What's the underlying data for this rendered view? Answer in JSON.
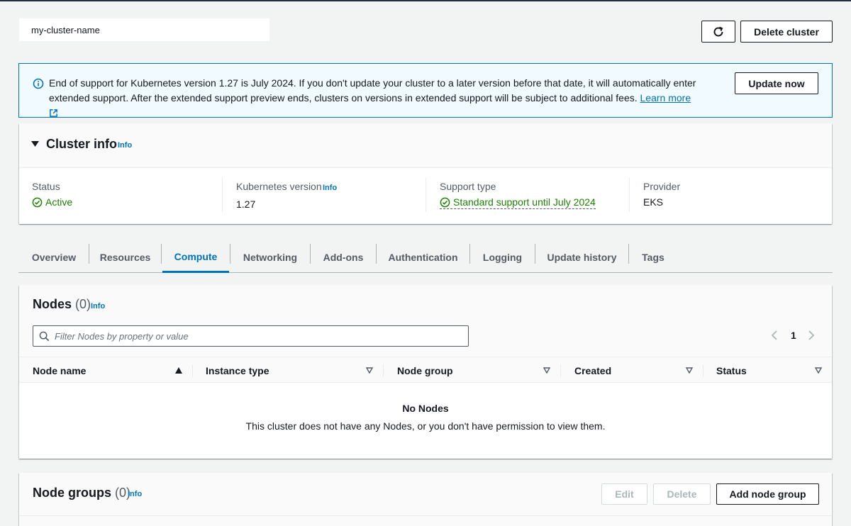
{
  "header": {
    "cluster_name": "my-cluster-name",
    "delete_label": "Delete cluster",
    "refresh_icon": "refresh-icon"
  },
  "alert": {
    "text": "End of support for Kubernetes version 1.27 is July 2024. If you don't update your cluster to a later version before that date, it will automatically enter extended support. After the extended support preview ends, clusters on versions in extended support will be subject to additional fees.",
    "link": "Learn more",
    "button": "Update now"
  },
  "cluster_info": {
    "title": "Cluster info",
    "info": "Info",
    "status_label": "Status",
    "status_value": "Active",
    "k8s_label": "Kubernetes version",
    "k8s_info": "Info",
    "k8s_value": "1.27",
    "support_label": "Support type",
    "support_value": "Standard support until July 2024",
    "provider_label": "Provider",
    "provider_value": "EKS"
  },
  "tabs": [
    {
      "label": "Overview"
    },
    {
      "label": "Resources"
    },
    {
      "label": "Compute"
    },
    {
      "label": "Networking"
    },
    {
      "label": "Add-ons"
    },
    {
      "label": "Authentication"
    },
    {
      "label": "Logging"
    },
    {
      "label": "Update history"
    },
    {
      "label": "Tags"
    }
  ],
  "active_tab": "Compute",
  "nodes": {
    "title": "Nodes",
    "count": "(0)",
    "info": "Info",
    "search_placeholder": "Filter Nodes by property or value",
    "page": "1",
    "columns": [
      "Node name",
      "Instance type",
      "Node group",
      "Created",
      "Status"
    ],
    "empty_title": "No Nodes",
    "empty_text": "This cluster does not have any Nodes, or you don't have permission to view them."
  },
  "node_groups": {
    "title": "Node groups",
    "count": "(0)",
    "info": "Info",
    "edit": "Edit",
    "delete": "Delete",
    "add": "Add node group"
  },
  "colors": {
    "accent": "#0073bb",
    "success": "#1d8102",
    "alert_bg": "#f1faff"
  }
}
